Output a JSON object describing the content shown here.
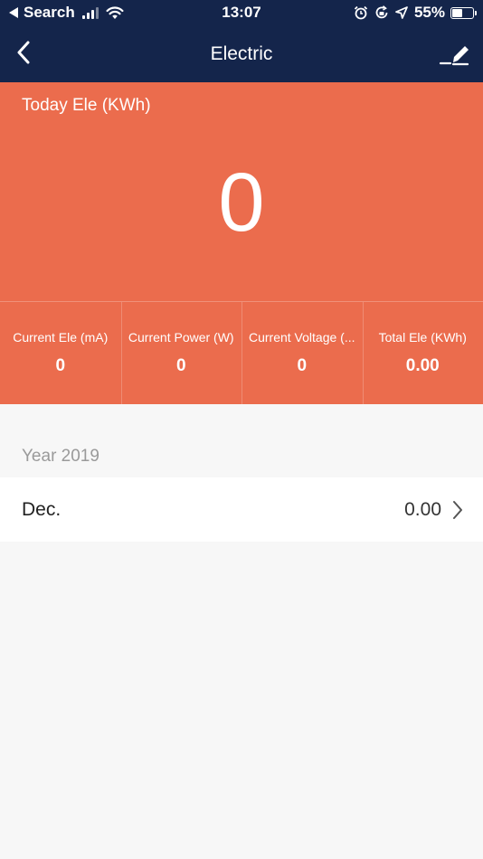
{
  "status_bar": {
    "back_app": "Search",
    "time": "13:07",
    "battery": "55%",
    "battery_level": 0.55,
    "icons": [
      "signal-icon",
      "wifi-icon",
      "alarm-icon",
      "rotation-lock-icon",
      "location-icon",
      "battery-icon"
    ]
  },
  "nav": {
    "title": "Electric",
    "back_icon": "chevron-left-icon",
    "edit_icon": "edit-pencil-icon"
  },
  "colors": {
    "nav_bg": "#14254b",
    "hero_bg": "#eb6c4d",
    "page_bg": "#f7f7f7"
  },
  "hero": {
    "label": "Today Ele (KWh)",
    "value": "0"
  },
  "stats": [
    {
      "name": "Current Ele (mA)",
      "value": "0"
    },
    {
      "name": "Current Power (W)",
      "value": "0"
    },
    {
      "name": "Current Voltage (...",
      "value": "0"
    },
    {
      "name": "Total Ele (KWh)",
      "value": "0.00"
    }
  ],
  "history": {
    "year_label": "Year 2019",
    "rows": [
      {
        "month": "Dec.",
        "value": "0.00"
      }
    ]
  }
}
